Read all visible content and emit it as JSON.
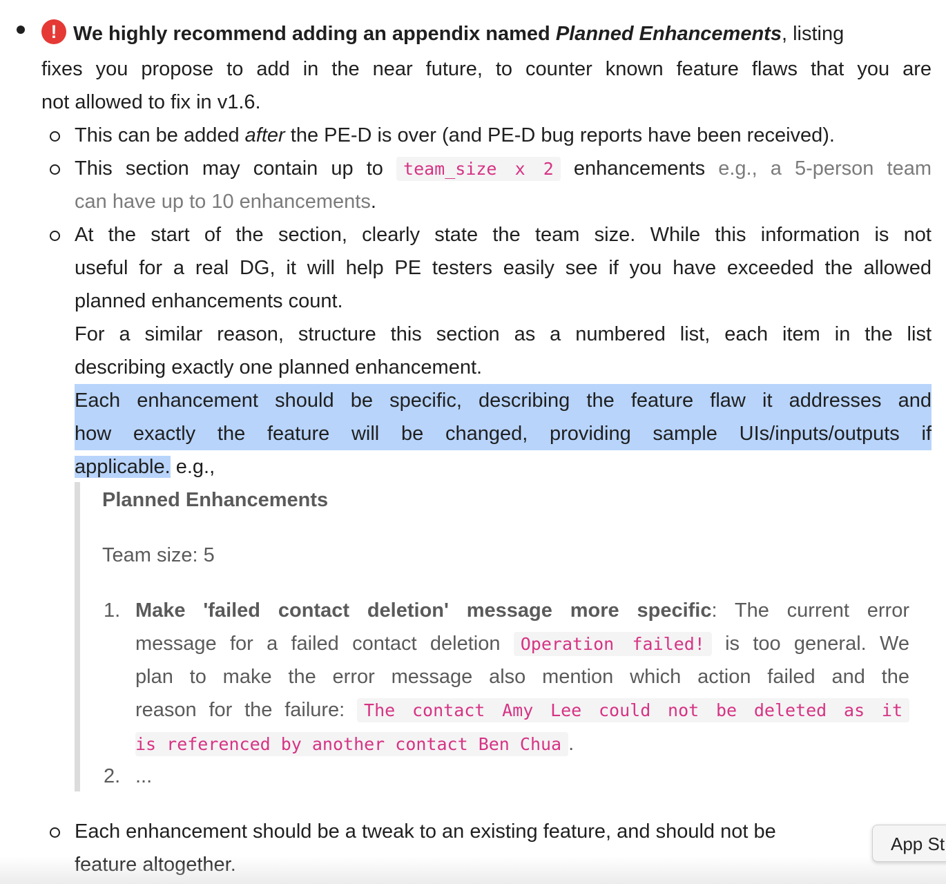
{
  "intro": {
    "warn_glyph": "!",
    "bold_a": "We highly recommend adding an appendix named ",
    "bold_b": "Planned Enhancements",
    "l1_tail": ", listing",
    "l2": "fixes you propose to add in the near future, to counter known feature flaws that you are",
    "l3": "not allowed to fix in v1.6."
  },
  "sub1": {
    "a": "This can be added ",
    "b": "after",
    "c": " the PE-D is over (and PE-D bug reports have been received)."
  },
  "sub2": {
    "a": "This section may contain up to ",
    "code": "team_size x 2",
    "b": " enhancements",
    "c": " e.g., a 5-person team",
    "d": "can have up to 10 enhancements",
    "e": "."
  },
  "sub3": {
    "l1": "At the start of the section, clearly state the team size. While this information is not",
    "l2": "useful for a real DG, it will help PE testers easily see if you have exceeded the allowed",
    "l3": "planned enhancements count.",
    "l4": "For a similar reason, structure this section as a numbered list, each item in the list",
    "l5": "describing exactly one planned enhancement.",
    "l6": "Each enhancement should be specific, describing the feature flaw it addresses and",
    "l7": "how exactly the feature will be changed, providing sample UIs/inputs/outputs if",
    "l8a": "applicable.",
    "l8b": " e.g.,"
  },
  "example": {
    "heading": "Planned Enhancements",
    "team": "Team size: 5",
    "item1": {
      "num": "1.",
      "bold": "Make 'failed contact deletion' message more specific",
      "l1_tail": ": The current error",
      "l2a": "message for a failed contact deletion ",
      "code1": "Operation failed!",
      "l2b": " is too general. We",
      "l3": "plan to make the error message also mention which action failed and the",
      "l4a": "reason for the failure: ",
      "code2a": "The contact Amy Lee could not be deleted as it",
      "code2b": "is referenced by another contact Ben Chua",
      "l5b": "."
    },
    "item2": {
      "num": "2.",
      "text": "..."
    }
  },
  "sub4": {
    "l1": "Each enhancement should be a tweak to an existing feature, and should not be",
    "l2": "feature altogether."
  },
  "tooltip": {
    "text": "App St"
  }
}
